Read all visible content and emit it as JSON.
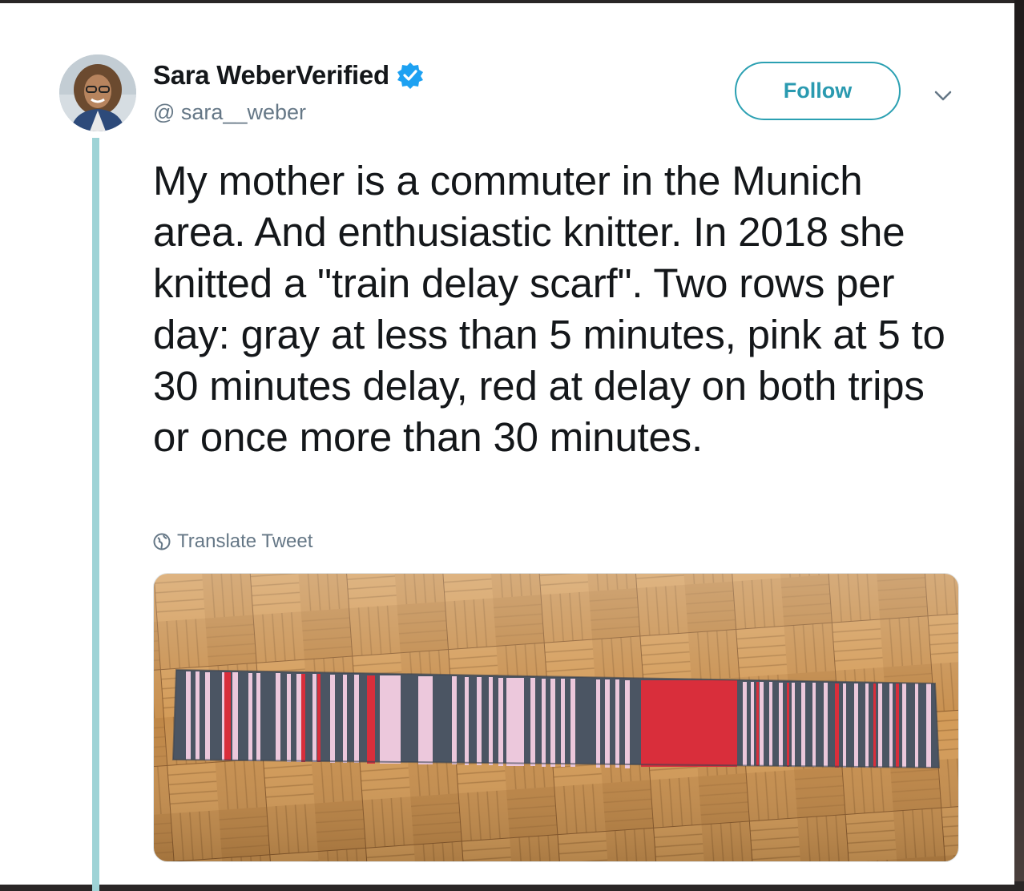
{
  "tweet": {
    "author_name": "Sara Weber",
    "verified_label": "Verified",
    "handle": "@ sara__weber",
    "follow_label": "Follow",
    "text": "My mother is a commuter in the Munich area. And enthusiastic knitter. In 2018 she knitted a \"train delay scarf\". Two rows per day: gray at less than 5 minutes, pink at 5 to 30 minutes delay, red at delay on both trips or once more than 30 minutes.",
    "translate_label": "Translate Tweet"
  },
  "icons": {
    "verified": "verified-badge-icon",
    "caret": "chevron-down-icon",
    "globe": "globe-icon"
  },
  "colors": {
    "text": "#14171a",
    "muted": "#657786",
    "accent": "#2a9ab0",
    "verified": "#1da1f2",
    "thread_line": "#9ed3d6",
    "scarf_gray": "#4b5563",
    "scarf_pink": "#ecc8dc",
    "scarf_red": "#d92e3b"
  }
}
